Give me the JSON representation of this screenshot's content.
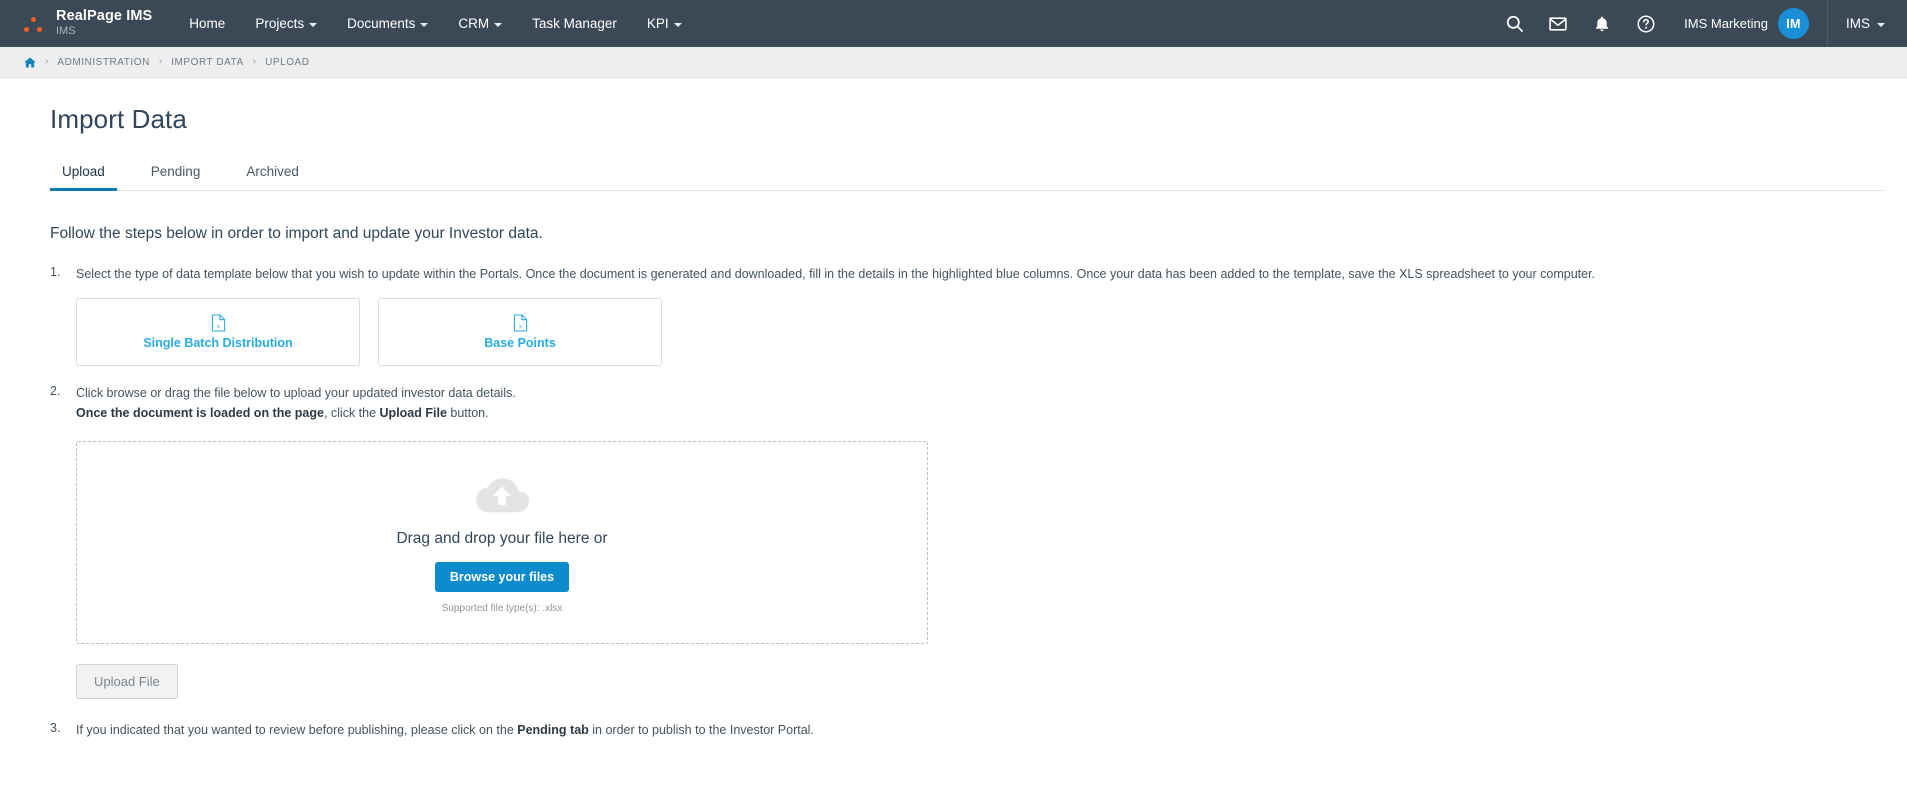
{
  "header": {
    "brand_name": "RealPage IMS",
    "brand_sub": "IMS",
    "nav_items": [
      {
        "label": "Home",
        "has_caret": false
      },
      {
        "label": "Projects",
        "has_caret": true
      },
      {
        "label": "Documents",
        "has_caret": true
      },
      {
        "label": "CRM",
        "has_caret": true
      },
      {
        "label": "Task Manager",
        "has_caret": false
      },
      {
        "label": "KPI",
        "has_caret": true
      }
    ],
    "icons": [
      "search-icon",
      "mail-icon",
      "bell-icon",
      "help-icon"
    ],
    "user_name": "IMS Marketing",
    "avatar_initials": "IM",
    "org_label": "IMS"
  },
  "breadcrumb": {
    "home": "home-icon",
    "items": [
      "ADMINISTRATION",
      "IMPORT DATA",
      "UPLOAD"
    ],
    "separator": "›"
  },
  "page": {
    "title": "Import Data",
    "tabs": [
      {
        "label": "Upload",
        "active": true
      },
      {
        "label": "Pending",
        "active": false
      },
      {
        "label": "Archived",
        "active": false
      }
    ],
    "lead": "Follow the steps below in order to import and update your Investor data.",
    "step1": {
      "text": "Select the type of data template below that you wish to update within the Portals. Once the document is generated and downloaded, fill in the details in the highlighted blue columns. Once your data has been added to the template, save the XLS spreadsheet to your computer.",
      "cards": [
        {
          "label": "Single Batch Distribution",
          "icon": "excel-file-icon"
        },
        {
          "label": "Base Points",
          "icon": "excel-file-icon"
        }
      ]
    },
    "step2": {
      "line1": "Click browse or drag the file below to upload your updated investor data details.",
      "bold1": "Once the document is loaded on the page",
      "mid": ", click the ",
      "bold2": "Upload File",
      "tail": " button.",
      "dropzone": {
        "icon": "cloud-upload-icon",
        "text": "Drag and drop your file here or",
        "button": "Browse your files",
        "note": "Supported file type(s): .xlsx"
      },
      "upload_button": "Upload File"
    },
    "step3": {
      "pre": "If you indicated that you wanted to review before publishing, please click on the ",
      "bold": "Pending tab",
      "post": " in order to publish to the Investor Portal."
    }
  },
  "colors": {
    "nav_bg": "#3b4957",
    "brand_dot": "#f26122",
    "accent_blue": "#0d8ccd",
    "link_blue": "#29abe2",
    "tab_active": "#0d7cb5",
    "avatar": "#1a8fd8",
    "text_dark": "#31465a"
  }
}
